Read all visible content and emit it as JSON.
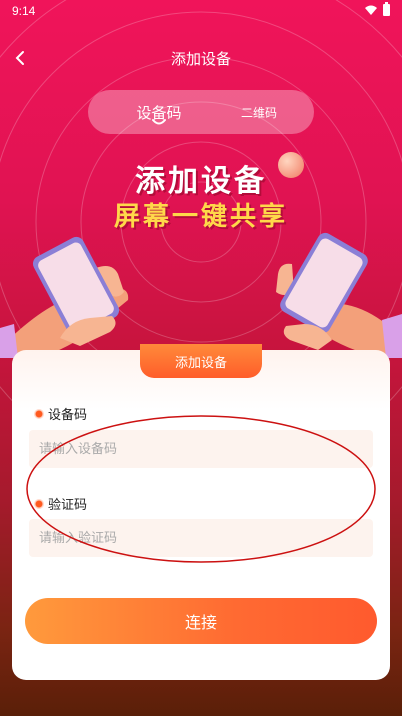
{
  "status_bar": {
    "time": "9:14"
  },
  "header": {
    "title": "添加设备"
  },
  "tabs": [
    {
      "label": "设备码",
      "selected": true
    },
    {
      "label": "二维码",
      "selected": false
    }
  ],
  "hero": {
    "title": "添加设备",
    "subtitle": "屏幕一键共享"
  },
  "card": {
    "tab_label": "添加设备",
    "device_code": {
      "label": "设备码",
      "placeholder": "请输入设备码",
      "value": ""
    },
    "verify_code": {
      "label": "验证码",
      "placeholder": "请输入验证码",
      "value": ""
    },
    "connect_label": "连接"
  },
  "colors": {
    "background_top": "#f0145a",
    "background_bottom": "#5a1f08",
    "accent_orange": "#ff6a32",
    "hero_subtitle": "#ffd84a",
    "annotation": "#cc1111"
  }
}
